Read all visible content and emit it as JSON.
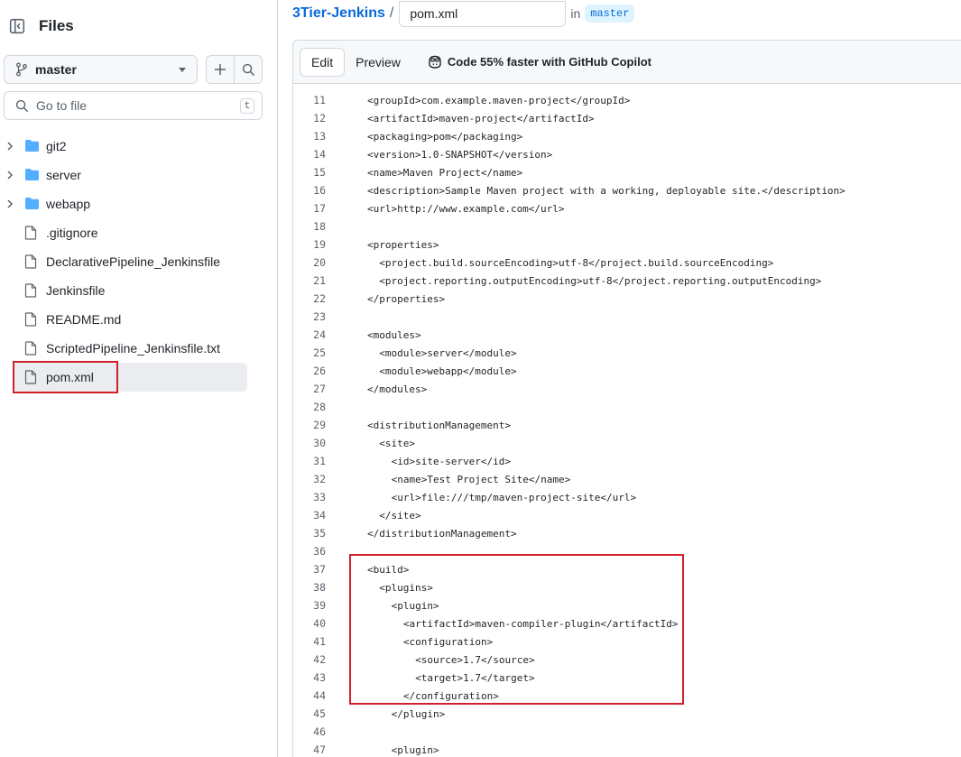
{
  "sidebar": {
    "title": "Files",
    "branch": "master",
    "goto_placeholder": "Go to file",
    "goto_shortcut": "t",
    "items": [
      {
        "label": "git2",
        "type": "folder"
      },
      {
        "label": "server",
        "type": "folder"
      },
      {
        "label": "webapp",
        "type": "folder"
      },
      {
        "label": ".gitignore",
        "type": "file"
      },
      {
        "label": "DeclarativePipeline_Jenkinsfile",
        "type": "file"
      },
      {
        "label": "Jenkinsfile",
        "type": "file"
      },
      {
        "label": "README.md",
        "type": "file"
      },
      {
        "label": "ScriptedPipeline_Jenkinsfile.txt",
        "type": "file"
      },
      {
        "label": "pom.xml",
        "type": "file",
        "selected": true
      }
    ]
  },
  "header": {
    "repo": "3Tier-Jenkins",
    "separator": "/",
    "filename": "pom.xml",
    "in_label": "in",
    "branch": "master"
  },
  "editor": {
    "tabs": [
      {
        "label": "Edit",
        "active": true
      },
      {
        "label": "Preview",
        "active": false
      }
    ],
    "copilot_text": "Code 55% faster with GitHub Copilot",
    "lines": [
      {
        "n": "11",
        "indent": 0,
        "text": "<groupId>com.example.maven-project</groupId>"
      },
      {
        "n": "12",
        "indent": 0,
        "text": "<artifactId>maven-project</artifactId>"
      },
      {
        "n": "13",
        "indent": 0,
        "text": "<packaging>pom</packaging>"
      },
      {
        "n": "14",
        "indent": 0,
        "text": "<version>1.0-SNAPSHOT</version>"
      },
      {
        "n": "15",
        "indent": 0,
        "text": "<name>Maven Project</name>"
      },
      {
        "n": "16",
        "indent": 0,
        "text": "<description>Sample Maven project with a working, deployable site.</description>"
      },
      {
        "n": "17",
        "indent": 0,
        "text": "<url>http://www.example.com</url>"
      },
      {
        "n": "18",
        "indent": 0,
        "text": ""
      },
      {
        "n": "19",
        "indent": 0,
        "text": "<properties>"
      },
      {
        "n": "20",
        "indent": 1,
        "text": "<project.build.sourceEncoding>utf-8</project.build.sourceEncoding>"
      },
      {
        "n": "21",
        "indent": 1,
        "text": "<project.reporting.outputEncoding>utf-8</project.reporting.outputEncoding>"
      },
      {
        "n": "22",
        "indent": 0,
        "text": "</properties>"
      },
      {
        "n": "23",
        "indent": 0,
        "text": ""
      },
      {
        "n": "24",
        "indent": 0,
        "text": "<modules>"
      },
      {
        "n": "25",
        "indent": 1,
        "text": "<module>server</module>"
      },
      {
        "n": "26",
        "indent": 1,
        "text": "<module>webapp</module>"
      },
      {
        "n": "27",
        "indent": 0,
        "text": "</modules>"
      },
      {
        "n": "28",
        "indent": 0,
        "text": ""
      },
      {
        "n": "29",
        "indent": 0,
        "text": "<distributionManagement>"
      },
      {
        "n": "30",
        "indent": 1,
        "text": "<site>"
      },
      {
        "n": "31",
        "indent": 2,
        "text": "<id>site-server</id>"
      },
      {
        "n": "32",
        "indent": 2,
        "text": "<name>Test Project Site</name>"
      },
      {
        "n": "33",
        "indent": 2,
        "text": "<url>file:///tmp/maven-project-site</url>"
      },
      {
        "n": "34",
        "indent": 1,
        "text": "</site>"
      },
      {
        "n": "35",
        "indent": 0,
        "text": "</distributionManagement>"
      },
      {
        "n": "36",
        "indent": 0,
        "text": ""
      },
      {
        "n": "37",
        "indent": 0,
        "text": "<build>"
      },
      {
        "n": "38",
        "indent": 1,
        "text": "<plugins>"
      },
      {
        "n": "39",
        "indent": 2,
        "text": "<plugin>"
      },
      {
        "n": "40",
        "indent": 3,
        "text": "<artifactId>maven-compiler-plugin</artifactId>"
      },
      {
        "n": "41",
        "indent": 3,
        "text": "<configuration>"
      },
      {
        "n": "42",
        "indent": 4,
        "text": "<source>1.7</source>"
      },
      {
        "n": "43",
        "indent": 4,
        "text": "<target>1.7</target>"
      },
      {
        "n": "44",
        "indent": 3,
        "text": "</configuration>"
      },
      {
        "n": "45",
        "indent": 2,
        "text": "</plugin>"
      },
      {
        "n": "46",
        "indent": 0,
        "text": ""
      },
      {
        "n": "47",
        "indent": 2,
        "text": "<plugin>"
      }
    ]
  }
}
